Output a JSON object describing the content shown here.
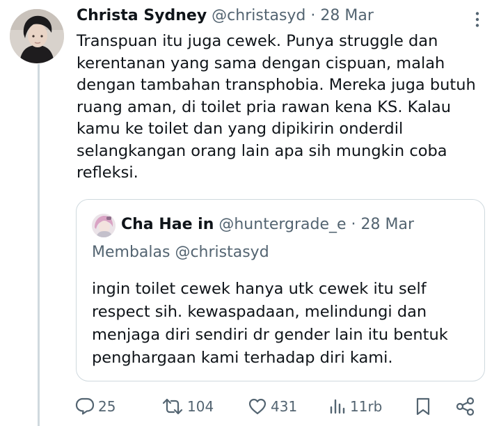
{
  "tweet": {
    "author_name": "Christa Sydney",
    "handle": "@christasyd",
    "separator": "·",
    "date": "28 Mar",
    "text": "Transpuan itu juga cewek. Punya struggle dan kerentanan yang sama dengan cispuan, malah dengan tambahan transphobia. Mereka juga butuh ruang aman, di toilet pria rawan kena KS. Kalau kamu ke toilet dan yang dipikirin onderdil selangkangan orang lain apa sih mungkin coba refleksi."
  },
  "quoted": {
    "author_name": "Cha Hae in",
    "handle": "@huntergrade_e",
    "separator": "·",
    "date": "28 Mar",
    "replying_to": "Membalas @christasyd",
    "text": "ingin toilet cewek hanya utk cewek itu self respect sih. kewaspadaan, melindungi dan menjaga diri sendiri dr gender lain itu bentuk penghargaan kami terhadap diri kami."
  },
  "actions": {
    "replies": "25",
    "reposts": "104",
    "likes": "431",
    "views": "11rb"
  },
  "icons": [
    "more-icon",
    "reply-icon",
    "repost-icon",
    "like-icon",
    "views-icon",
    "bookmark-icon",
    "share-icon"
  ],
  "colors": {
    "text": "#0f1419",
    "muted": "#536471",
    "border": "#cfd9de"
  }
}
